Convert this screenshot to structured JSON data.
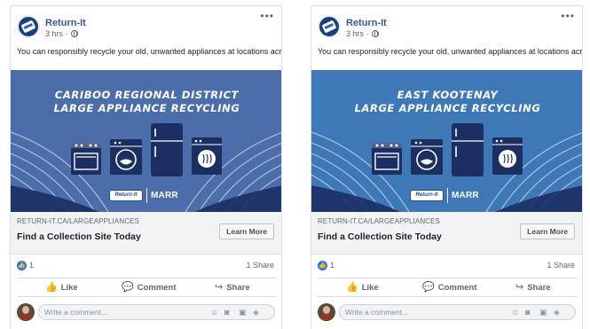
{
  "posts": [
    {
      "page_name": "Return-It",
      "time": "3 hrs",
      "text": "You can responsibly recycle your old, unwanted appliances at locations across BC.",
      "banner": {
        "line1": "CARIBOO REGIONAL DISTRICT",
        "line2": "LARGE APPLIANCE RECYCLING",
        "logo_returnit": "Return-It",
        "logo_marr": "MARR"
      },
      "link": {
        "url": "RETURN-IT.CA/LARGEAPPLIANCES",
        "title": "Find a Collection Site Today",
        "button": "Learn More"
      },
      "counts": {
        "likes": "1",
        "shares": "1 Share"
      },
      "actions": {
        "like": "Like",
        "comment": "Comment",
        "share": "Share"
      },
      "comment_placeholder": "Write a comment..."
    },
    {
      "page_name": "Return-It",
      "time": "3 hrs",
      "text": "You can responsibly recycle your old, unwanted appliances at locations across BC.",
      "banner": {
        "line1": "EAST KOOTENAY",
        "line2": "LARGE APPLIANCE RECYCLING",
        "logo_returnit": "Return-It",
        "logo_marr": "MARR"
      },
      "link": {
        "url": "RETURN-IT.CA/LARGEAPPLIANCES",
        "title": "Find a Collection Site Today",
        "button": "Learn More"
      },
      "counts": {
        "likes": "1",
        "shares": "1 Share"
      },
      "actions": {
        "like": "Like",
        "comment": "Comment",
        "share": "Share"
      },
      "comment_placeholder": "Write a comment..."
    }
  ],
  "colors": {
    "link_blue": "#385898",
    "banner_cariboo": "#4b6eab",
    "banner_kootenay": "#3f78b7",
    "appliance_navy": "#1b2f63",
    "like_blue": "#2078f4"
  },
  "icons": [
    "globe-icon",
    "more-options-icon",
    "thumbs-up-icon",
    "comment-bubble-icon",
    "share-arrow-icon",
    "emoji-icon",
    "camera-icon",
    "gif-icon",
    "sticker-icon"
  ]
}
